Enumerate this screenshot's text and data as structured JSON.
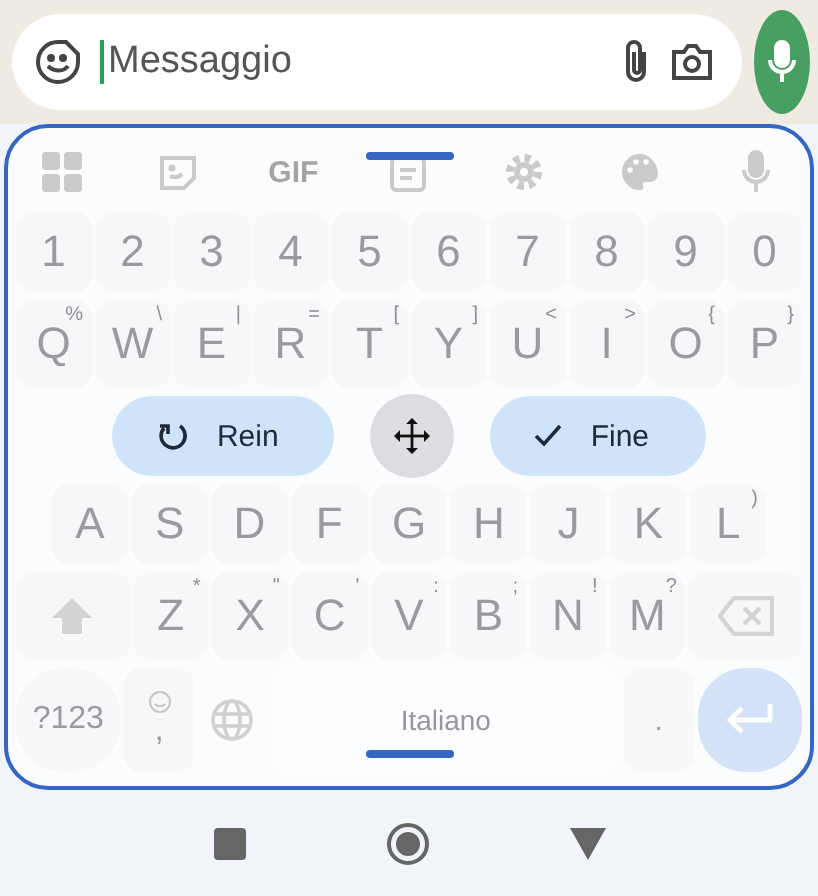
{
  "message_bar": {
    "placeholder": "Messaggio"
  },
  "toolbar": [
    {
      "kind": "apps"
    },
    {
      "kind": "sticker"
    },
    {
      "kind": "text",
      "label": "GIF"
    },
    {
      "kind": "clipboard"
    },
    {
      "kind": "settings"
    },
    {
      "kind": "palette"
    },
    {
      "kind": "mic"
    }
  ],
  "number_row": [
    "1",
    "2",
    "3",
    "4",
    "5",
    "6",
    "7",
    "8",
    "9",
    "0"
  ],
  "resize_controls": [
    {
      "kind": "reset",
      "label": "Rein"
    },
    {
      "kind": "move"
    },
    {
      "kind": "done",
      "label": "Fine"
    }
  ],
  "letter_rows": [
    [
      {
        "label": "Q",
        "hint": "%"
      },
      {
        "label": "W",
        "hint": "\\"
      },
      {
        "label": "E",
        "hint": "|"
      },
      {
        "label": "R",
        "hint": "="
      },
      {
        "label": "T",
        "hint": "["
      },
      {
        "label": "Y",
        "hint": "]"
      },
      {
        "label": "U",
        "hint": "<"
      },
      {
        "label": "I",
        "hint": ">"
      },
      {
        "label": "O",
        "hint": "{"
      },
      {
        "label": "P",
        "hint": "}"
      }
    ],
    [
      {
        "label": "A"
      },
      {
        "label": "S"
      },
      {
        "label": "D"
      },
      {
        "label": "F"
      },
      {
        "label": "G"
      },
      {
        "label": "H"
      },
      {
        "label": "J"
      },
      {
        "label": "K"
      },
      {
        "label": "L",
        "hint": ")"
      }
    ],
    [
      {
        "label": "Z",
        "hint": "*"
      },
      {
        "label": "X",
        "hint": "\""
      },
      {
        "label": "C",
        "hint": "'"
      },
      {
        "label": "V",
        "hint": ":"
      },
      {
        "label": "B",
        "hint": ";"
      },
      {
        "label": "N",
        "hint": "!"
      },
      {
        "label": "M",
        "hint": "?"
      }
    ]
  ],
  "bottom_row": {
    "symbols": "?123",
    "comma": ",",
    "space": "Italiano",
    "period": "."
  }
}
